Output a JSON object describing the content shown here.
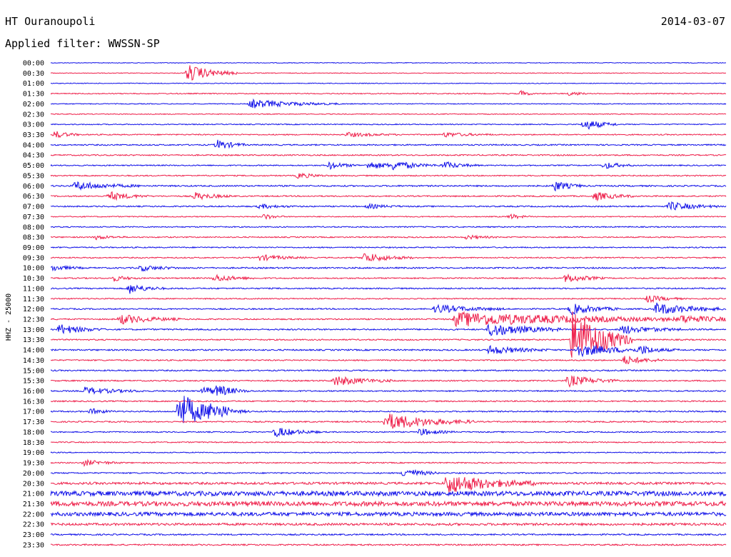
{
  "header": {
    "station": "HT Ouranoupoli",
    "date": "2014-03-07",
    "filter": "Applied filter: WWSSN-SP",
    "channel": "HHZ - 25000"
  },
  "colors": {
    "even_trace": "#1010e8",
    "odd_trace": "#ee1f4a",
    "text": "#000000"
  },
  "chart_data": {
    "type": "line",
    "title": "HT Ouranoupoli",
    "subtitle": "Applied filter: WWSSN-SP",
    "ylabel": "HHZ - 25000",
    "xlabel": "",
    "grid": false,
    "legend": "none",
    "row_labels": [
      "00:00",
      "00:30",
      "01:00",
      "01:30",
      "02:00",
      "02:30",
      "03:00",
      "03:30",
      "04:00",
      "04:30",
      "05:00",
      "05:30",
      "06:00",
      "06:30",
      "07:00",
      "07:30",
      "08:00",
      "08:30",
      "09:00",
      "09:30",
      "10:00",
      "10:30",
      "11:00",
      "11:30",
      "12:00",
      "12:30",
      "13:00",
      "13:30",
      "14:00",
      "14:30",
      "15:00",
      "15:30",
      "16:00",
      "16:30",
      "17:00",
      "17:30",
      "18:00",
      "18:30",
      "19:00",
      "19:30",
      "20:00",
      "20:30",
      "21:00",
      "21:30",
      "22:00",
      "22:30",
      "23:00",
      "23:30"
    ],
    "x_range_minutes": [
      0,
      30
    ],
    "noise_level": [
      0.5,
      0.5,
      0.5,
      0.7,
      0.6,
      0.6,
      0.7,
      0.8,
      0.9,
      0.9,
      0.8,
      0.8,
      1.0,
      0.9,
      0.9,
      0.7,
      0.8,
      0.8,
      0.8,
      0.8,
      1.0,
      0.9,
      0.9,
      0.8,
      0.9,
      0.9,
      1.0,
      0.9,
      1.0,
      0.9,
      0.9,
      0.9,
      0.9,
      0.9,
      0.9,
      0.9,
      0.8,
      0.8,
      0.7,
      0.8,
      0.9,
      1.6,
      3.2,
      3.2,
      2.6,
      1.6,
      1.0,
      1.0
    ],
    "events": [
      {
        "row": 1,
        "minute": 6.1,
        "amplitude": 12,
        "duration": 1.0
      },
      {
        "row": 3,
        "minute": 20.9,
        "amplitude": 4,
        "duration": 0.3
      },
      {
        "row": 3,
        "minute": 23.1,
        "amplitude": 4,
        "duration": 0.3
      },
      {
        "row": 4,
        "minute": 8.9,
        "amplitude": 6,
        "duration": 1.8
      },
      {
        "row": 6,
        "minute": 23.7,
        "amplitude": 8,
        "duration": 0.7
      },
      {
        "row": 7,
        "minute": 0.2,
        "amplitude": 5,
        "duration": 0.5
      },
      {
        "row": 7,
        "minute": 13.2,
        "amplitude": 3,
        "duration": 1.0
      },
      {
        "row": 7,
        "minute": 17.5,
        "amplitude": 3,
        "duration": 1.0
      },
      {
        "row": 8,
        "minute": 7.4,
        "amplitude": 7,
        "duration": 0.6
      },
      {
        "row": 10,
        "minute": 12.4,
        "amplitude": 5,
        "duration": 0.6
      },
      {
        "row": 10,
        "minute": 14.1,
        "amplitude": 5,
        "duration": 1.0
      },
      {
        "row": 10,
        "minute": 15.2,
        "amplitude": 5,
        "duration": 1.0
      },
      {
        "row": 10,
        "minute": 17.5,
        "amplitude": 5,
        "duration": 0.7
      },
      {
        "row": 10,
        "minute": 24.6,
        "amplitude": 5,
        "duration": 0.6
      },
      {
        "row": 11,
        "minute": 11.0,
        "amplitude": 4,
        "duration": 0.6
      },
      {
        "row": 12,
        "minute": 1.1,
        "amplitude": 6,
        "duration": 1.3
      },
      {
        "row": 12,
        "minute": 22.4,
        "amplitude": 7,
        "duration": 0.6
      },
      {
        "row": 13,
        "minute": 2.6,
        "amplitude": 6,
        "duration": 0.8
      },
      {
        "row": 13,
        "minute": 6.4,
        "amplitude": 5,
        "duration": 0.8
      },
      {
        "row": 13,
        "minute": 24.2,
        "amplitude": 6,
        "duration": 0.8
      },
      {
        "row": 14,
        "minute": 9.3,
        "amplitude": 3,
        "duration": 0.7
      },
      {
        "row": 14,
        "minute": 14.1,
        "amplitude": 3,
        "duration": 0.7
      },
      {
        "row": 14,
        "minute": 27.5,
        "amplitude": 6,
        "duration": 1.0
      },
      {
        "row": 15,
        "minute": 9.5,
        "amplitude": 4,
        "duration": 0.4
      },
      {
        "row": 15,
        "minute": 20.4,
        "amplitude": 4,
        "duration": 0.4
      },
      {
        "row": 17,
        "minute": 2.0,
        "amplitude": 3,
        "duration": 0.6
      },
      {
        "row": 17,
        "minute": 18.5,
        "amplitude": 3,
        "duration": 0.6
      },
      {
        "row": 19,
        "minute": 9.3,
        "amplitude": 4,
        "duration": 1.0
      },
      {
        "row": 19,
        "minute": 13.9,
        "amplitude": 7,
        "duration": 1.0
      },
      {
        "row": 20,
        "minute": 0.1,
        "amplitude": 4,
        "duration": 0.6
      },
      {
        "row": 20,
        "minute": 4.0,
        "amplitude": 4,
        "duration": 0.8
      },
      {
        "row": 21,
        "minute": 2.8,
        "amplitude": 4,
        "duration": 0.5
      },
      {
        "row": 21,
        "minute": 7.3,
        "amplitude": 5,
        "duration": 0.8
      },
      {
        "row": 21,
        "minute": 22.9,
        "amplitude": 6,
        "duration": 0.8
      },
      {
        "row": 22,
        "minute": 3.5,
        "amplitude": 7,
        "duration": 0.7
      },
      {
        "row": 23,
        "minute": 26.5,
        "amplitude": 5,
        "duration": 0.7
      },
      {
        "row": 24,
        "minute": 17.1,
        "amplitude": 6,
        "duration": 1.4
      },
      {
        "row": 24,
        "minute": 23.1,
        "amplitude": 8,
        "duration": 1.0
      },
      {
        "row": 24,
        "minute": 26.9,
        "amplitude": 8,
        "duration": 1.5
      },
      {
        "row": 25,
        "minute": 3.1,
        "amplitude": 7,
        "duration": 1.2
      },
      {
        "row": 25,
        "minute": 18.0,
        "amplitude": 10,
        "duration": 5.5
      },
      {
        "row": 25,
        "minute": 28.0,
        "amplitude": 4,
        "duration": 1.2
      },
      {
        "row": 26,
        "minute": 0.4,
        "amplitude": 7,
        "duration": 0.9
      },
      {
        "row": 26,
        "minute": 19.5,
        "amplitude": 10,
        "duration": 1.5
      },
      {
        "row": 26,
        "minute": 25.4,
        "amplitude": 6,
        "duration": 1.2
      },
      {
        "row": 27,
        "minute": 23.2,
        "amplitude": 45,
        "duration": 1.2
      },
      {
        "row": 28,
        "minute": 19.5,
        "amplitude": 6,
        "duration": 1.2
      },
      {
        "row": 28,
        "minute": 23.4,
        "amplitude": 9,
        "duration": 1.5
      },
      {
        "row": 28,
        "minute": 26.2,
        "amplitude": 5,
        "duration": 0.8
      },
      {
        "row": 29,
        "minute": 25.5,
        "amplitude": 6,
        "duration": 0.8
      },
      {
        "row": 31,
        "minute": 12.6,
        "amplitude": 7,
        "duration": 1.2
      },
      {
        "row": 31,
        "minute": 23.0,
        "amplitude": 8,
        "duration": 1.0
      },
      {
        "row": 32,
        "minute": 1.5,
        "amplitude": 5,
        "duration": 1.2
      },
      {
        "row": 32,
        "minute": 6.8,
        "amplitude": 6,
        "duration": 0.7
      },
      {
        "row": 32,
        "minute": 7.4,
        "amplitude": 6,
        "duration": 0.7
      },
      {
        "row": 34,
        "minute": 1.8,
        "amplitude": 4,
        "duration": 0.5
      },
      {
        "row": 34,
        "minute": 5.7,
        "amplitude": 28,
        "duration": 1.0
      },
      {
        "row": 34,
        "minute": 7.1,
        "amplitude": 7,
        "duration": 0.8
      },
      {
        "row": 35,
        "minute": 14.9,
        "amplitude": 12,
        "duration": 1.8
      },
      {
        "row": 36,
        "minute": 10.0,
        "amplitude": 7,
        "duration": 0.9
      },
      {
        "row": 36,
        "minute": 16.4,
        "amplitude": 5,
        "duration": 0.7
      },
      {
        "row": 39,
        "minute": 1.5,
        "amplitude": 4,
        "duration": 0.8
      },
      {
        "row": 40,
        "minute": 15.7,
        "amplitude": 7,
        "duration": 0.7
      },
      {
        "row": 41,
        "minute": 17.6,
        "amplitude": 14,
        "duration": 1.8
      }
    ]
  }
}
